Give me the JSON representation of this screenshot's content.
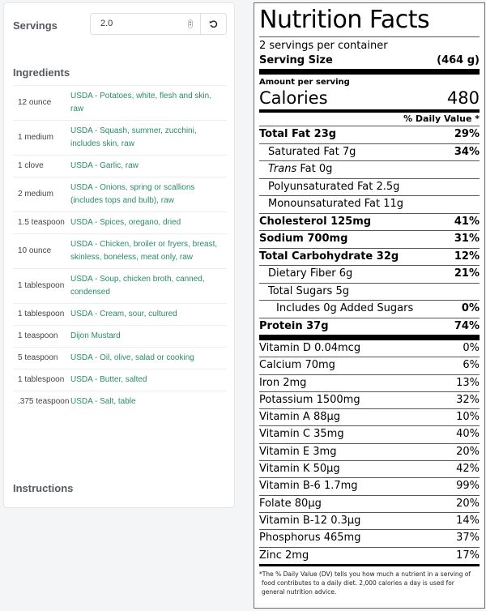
{
  "servings": {
    "label": "Servings",
    "value": "2.0",
    "reset_icon": "reset-icon"
  },
  "ingredients": {
    "title": "Ingredients",
    "items": [
      {
        "qty": "12 ounce",
        "name": "USDA - Potatoes, white, flesh and skin, raw"
      },
      {
        "qty": "1 medium",
        "name": "USDA - Squash, summer, zucchini, includes skin, raw"
      },
      {
        "qty": "1 clove",
        "name": "USDA - Garlic, raw"
      },
      {
        "qty": "2 medium",
        "name": "USDA - Onions, spring or scallions (includes tops and bulb), raw"
      },
      {
        "qty": "1.5 teaspoon",
        "name": "USDA - Spices, oregano, dried"
      },
      {
        "qty": "10 ounce",
        "name": "USDA - Chicken, broiler or fryers, breast, skinless, boneless, meat only, raw"
      },
      {
        "qty": "1 tablespoon",
        "name": "USDA - Soup, chicken broth, canned, condensed"
      },
      {
        "qty": "1 tablespoon",
        "name": "USDA - Cream, sour, cultured"
      },
      {
        "qty": "1 teaspoon",
        "name": "Dijon Mustard"
      },
      {
        "qty": "5 teaspoon",
        "name": "USDA - Oil, olive, salad or cooking"
      },
      {
        "qty": "1 tablespoon",
        "name": "USDA - Butter, salted"
      },
      {
        "qty": ".375 teaspoon",
        "name": "USDA - Salt, table"
      }
    ]
  },
  "instructions": {
    "title": "Instructions"
  },
  "nutrition": {
    "title": "Nutrition Facts",
    "servings_per_container": "2 servings per container",
    "serving_size_label": "Serving Size",
    "serving_size_value": "(464 g)",
    "amount_per_serving": "Amount per serving",
    "calories_label": "Calories",
    "calories_value": "480",
    "dv_header": "% Daily Value *",
    "nutrients": [
      {
        "label": "Total Fat 23g",
        "dv": "29%"
      },
      {
        "label": "Saturated Fat 7g",
        "dv": "34%"
      },
      {
        "label_italic": "Trans",
        "label": " Fat 0g",
        "dv": ""
      },
      {
        "label": "Polyunsaturated Fat 2.5g",
        "dv": ""
      },
      {
        "label": "Monounsaturated Fat 11g",
        "dv": ""
      },
      {
        "label": "Cholesterol 125mg",
        "dv": "41%"
      },
      {
        "label": "Sodium 700mg",
        "dv": "31%"
      },
      {
        "label": "Total Carbohydrate 32g",
        "dv": "12%"
      },
      {
        "label": "Dietary Fiber 6g",
        "dv": "21%"
      },
      {
        "label": "Total Sugars 5g",
        "dv": ""
      },
      {
        "label": "Includes 0g Added Sugars",
        "dv": "0%"
      },
      {
        "label": "Protein 37g",
        "dv": "74%"
      }
    ],
    "vitamins": [
      {
        "label": "Vitamin D 0.04mcg",
        "dv": "0%"
      },
      {
        "label": "Calcium 70mg",
        "dv": "6%"
      },
      {
        "label": "Iron 2mg",
        "dv": "13%"
      },
      {
        "label": "Potassium 1500mg",
        "dv": "32%"
      },
      {
        "label": "Vitamin A 88µg",
        "dv": "10%"
      },
      {
        "label": "Vitamin C 35mg",
        "dv": "40%"
      },
      {
        "label": "Vitamin E 3mg",
        "dv": "20%"
      },
      {
        "label": "Vitamin K 50µg",
        "dv": "42%"
      },
      {
        "label": "Vitamin B-6 1.7mg",
        "dv": "99%"
      },
      {
        "label": "Folate 80µg",
        "dv": "20%"
      },
      {
        "label": "Vitamin B-12 0.3µg",
        "dv": "14%"
      },
      {
        "label": "Phosphorus 465mg",
        "dv": "37%"
      },
      {
        "label": "Zinc 2mg",
        "dv": "17%"
      }
    ],
    "footnote_line1": "*The % Daily Value (DV) tells you how much a nutrient in a serving of",
    "footnote_line2": "food contributes to a daily diet. 2,000 calories a day is used for",
    "footnote_line3": "general nutrition advice."
  }
}
